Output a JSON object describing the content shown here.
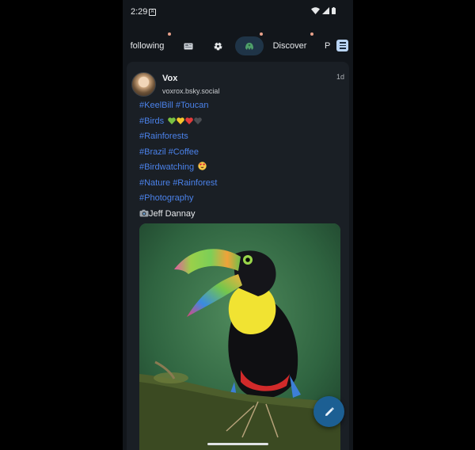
{
  "status_bar": {
    "time": "2:29"
  },
  "tabs": {
    "following": "following",
    "discover": "Discover",
    "partial": "P"
  },
  "post": {
    "author": "Vox",
    "handle": "voxrox.bsky.social",
    "time": "1d",
    "lines": [
      "#KeelBill #Toucan",
      "#Birds",
      "#Rainforests",
      "#Brazil #Coffee",
      "#Birdwatching",
      "#Nature #Rainforest",
      "#Photography",
      "Jeff Dannay"
    ]
  },
  "colors": {
    "accent": "#3f7ce8",
    "fab": "#1c5f93",
    "background": "#12161b",
    "card": "#1a1f25"
  }
}
